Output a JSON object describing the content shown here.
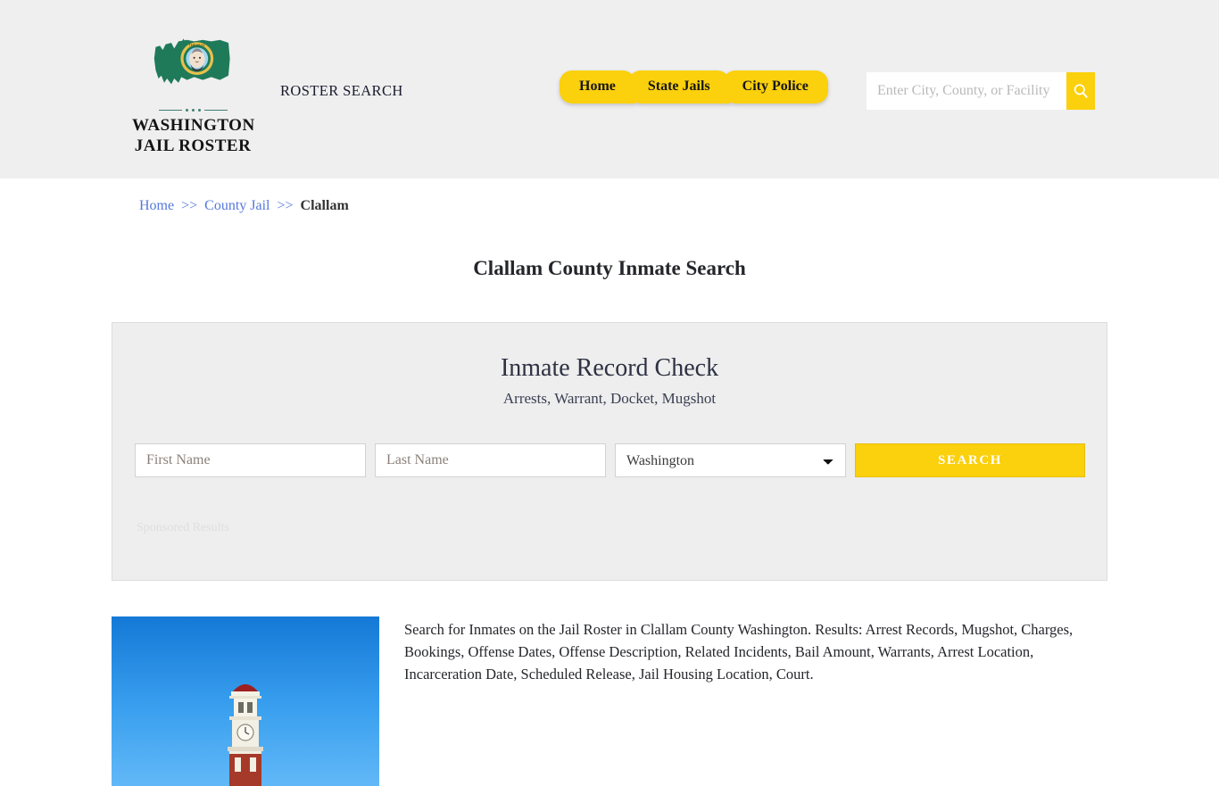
{
  "header": {
    "logo": {
      "icon": "washington-state-flag-icon",
      "line1": "WASHINGTON",
      "line2": "JAIL ROSTER"
    },
    "tagline": "ROSTER SEARCH",
    "nav": [
      {
        "label": "Home"
      },
      {
        "label": "State Jails"
      },
      {
        "label": "City Police"
      }
    ],
    "search": {
      "placeholder": "Enter City, County, or Facility",
      "value": "",
      "button_icon": "search-icon"
    }
  },
  "breadcrumb": {
    "items": [
      {
        "label": "Home",
        "link": true
      },
      {
        "label": "County Jail",
        "link": true
      },
      {
        "label": "Clallam",
        "link": false
      }
    ],
    "separator": ">>"
  },
  "page_title": "Clallam County Inmate Search",
  "search_panel": {
    "title": "Inmate Record Check",
    "subtitle": "Arrests, Warrant, Docket, Mugshot",
    "first_name": {
      "placeholder": "First Name",
      "value": ""
    },
    "last_name": {
      "placeholder": "Last Name",
      "value": ""
    },
    "state": {
      "selected": "Washington",
      "options": [
        "Washington"
      ]
    },
    "submit_label": "SEARCH",
    "sponsored_label": "Sponsored Results"
  },
  "content": {
    "photo_alt": "Clallam County Courthouse clock tower",
    "description": "Search for Inmates on the Jail Roster in Clallam County Washington. Results: Arrest Records, Mugshot, Charges, Bookings, Offense Dates, Offense Description, Related Incidents, Bail Amount, Warrants, Arrest Location, Incarceration Date, Scheduled Release, Jail Housing Location, Court."
  },
  "colors": {
    "accent_yellow": "#fbd00c",
    "header_bg": "#efefef",
    "panel_bg": "#eeeeee",
    "link_blue": "#5577dd",
    "text_dark": "#25262b"
  }
}
